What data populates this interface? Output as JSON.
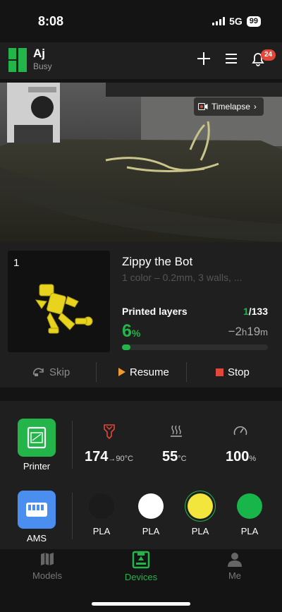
{
  "status_bar": {
    "time": "8:08",
    "network": "5G",
    "battery": "99"
  },
  "header": {
    "printer_name": "Aj",
    "printer_status": "Busy",
    "notification_count": "24"
  },
  "camera": {
    "timelapse_label": "Timelapse"
  },
  "job": {
    "plate_number": "1",
    "title": "Zippy the Bot",
    "subtitle": "1 color – 0.2mm, 3 walls, ...",
    "layers_label": "Printed layers",
    "layer_current": "1",
    "layer_total": "/133",
    "progress_value": "6",
    "progress_unit": "%",
    "progress_fraction": 0.06,
    "remaining_prefix": "−2",
    "remaining_h": "h",
    "remaining_min": "19",
    "remaining_m": "m"
  },
  "controls": {
    "skip": "Skip",
    "resume": "Resume",
    "stop": "Stop"
  },
  "stats": {
    "printer_label": "Printer",
    "nozzle_temp": "174",
    "nozzle_target": "→90°C",
    "bed_temp": "55",
    "bed_unit": "°C",
    "fan_speed": "100",
    "fan_unit": "%"
  },
  "ams": {
    "label": "AMS",
    "spools": [
      {
        "label": "PLA",
        "color": "#1b1b1b"
      },
      {
        "label": "PLA",
        "color": "#ffffff"
      },
      {
        "label": "PLA",
        "color": "#f2e53c"
      },
      {
        "label": "PLA",
        "color": "#18b64a"
      }
    ]
  },
  "tabs": {
    "models": "Models",
    "devices": "Devices",
    "me": "Me"
  },
  "colors": {
    "accent": "#23b44a",
    "stop": "#e2473a",
    "resume": "#f29a2e"
  }
}
